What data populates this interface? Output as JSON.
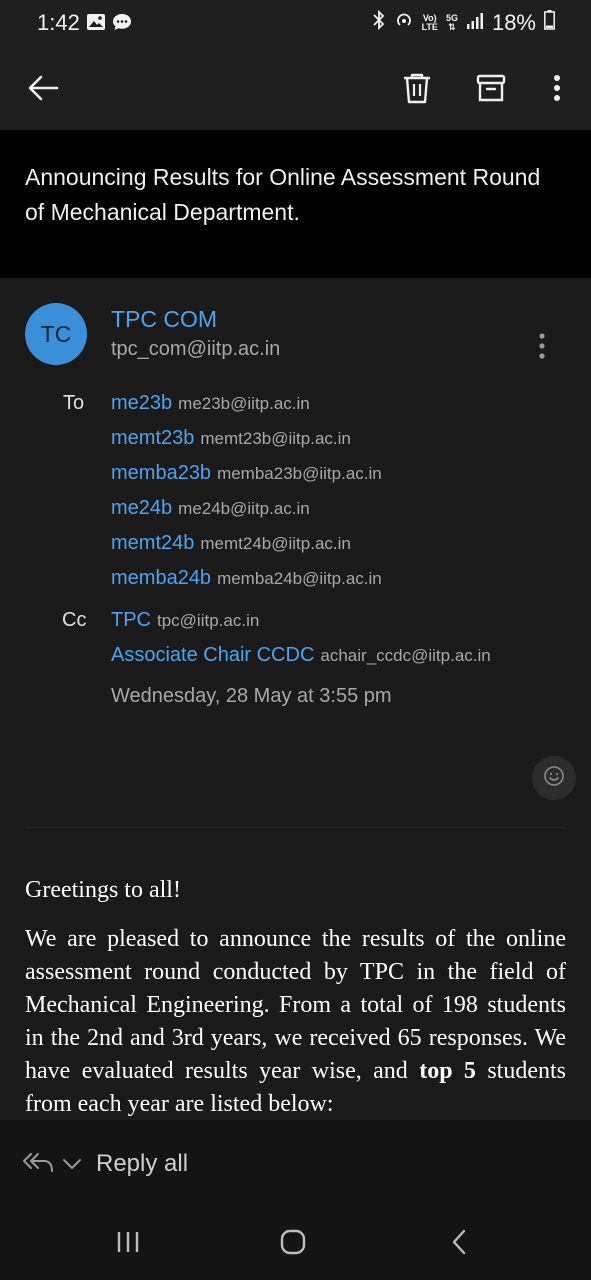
{
  "status_bar": {
    "time": "1:42",
    "lte_top": "Vo)",
    "lte_bottom": "LTE",
    "network": "5G",
    "battery": "18%"
  },
  "toolbar": {
    "icons": [
      "back-arrow-icon",
      "trash-icon",
      "archive-icon",
      "more-vert-icon"
    ]
  },
  "email": {
    "subject": "Announcing Results for Online Assessment Round of Mechanical Department.",
    "sender": {
      "initials": "TC",
      "name": "TPC COM",
      "email": "tpc_com@iitp.ac.in"
    },
    "to_label": "To",
    "to": [
      {
        "name": "me23b",
        "email": "me23b@iitp.ac.in"
      },
      {
        "name": "memt23b",
        "email": "memt23b@iitp.ac.in"
      },
      {
        "name": "memba23b",
        "email": "memba23b@iitp.ac.in"
      },
      {
        "name": "me24b",
        "email": "me24b@iitp.ac.in"
      },
      {
        "name": "memt24b",
        "email": "memt24b@iitp.ac.in"
      },
      {
        "name": "memba24b",
        "email": "memba24b@iitp.ac.in"
      }
    ],
    "cc_label": "Cc",
    "cc": [
      {
        "name": "TPC",
        "email": "tpc@iitp.ac.in"
      },
      {
        "name": "Associate Chair CCDC",
        "email": "achair_ccdc@iitp.ac.in"
      }
    ],
    "date": "Wednesday, 28 May at 3:55 pm",
    "body": {
      "greeting": "Greetings to all!",
      "para_part1": "We are pleased to announce the results of the online assessment round conducted by TPC in the field of Mechanical Engineering. From a total of 198 students in the 2nd and 3rd years, we received 65 responses. We have evaluated results year wise, and ",
      "para_bold": "top 5",
      "para_part2": " students from each year are listed below:"
    }
  },
  "reply_bar": {
    "label": "Reply all"
  },
  "colors": {
    "accent": "#4ea3f0",
    "avatar": "#3b8fd8",
    "background": "#000000",
    "card": "#1a1a1a"
  }
}
